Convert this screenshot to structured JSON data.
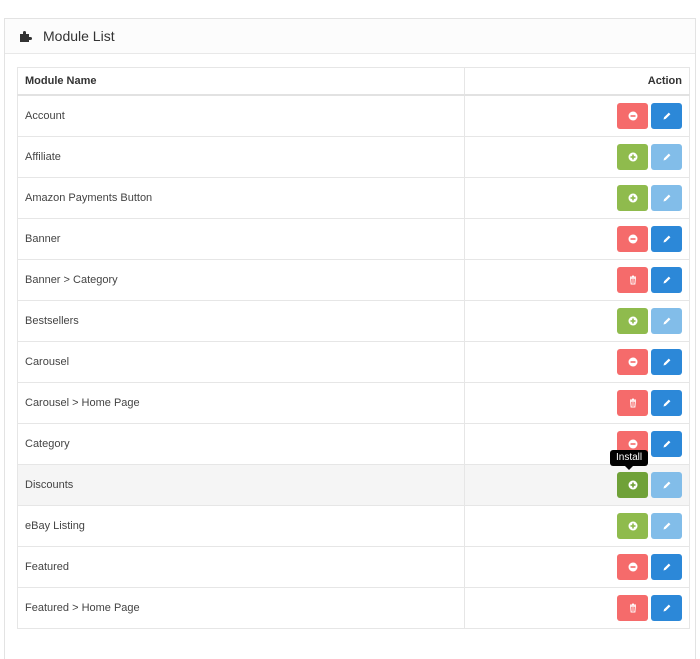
{
  "panel": {
    "title": "Module List",
    "title_icon": "puzzle-icon"
  },
  "table": {
    "headers": {
      "name": "Module Name",
      "action": "Action"
    },
    "rows": [
      {
        "name": "Account",
        "primary": "uninstall",
        "edit_enabled": true
      },
      {
        "name": "Affiliate",
        "primary": "install",
        "edit_enabled": false
      },
      {
        "name": "Amazon Payments Button",
        "primary": "install",
        "edit_enabled": false
      },
      {
        "name": "Banner",
        "primary": "uninstall",
        "edit_enabled": true
      },
      {
        "name": "Banner > Category",
        "primary": "delete",
        "edit_enabled": true
      },
      {
        "name": "Bestsellers",
        "primary": "install",
        "edit_enabled": false
      },
      {
        "name": "Carousel",
        "primary": "uninstall",
        "edit_enabled": true
      },
      {
        "name": "Carousel > Home Page",
        "primary": "delete",
        "edit_enabled": true
      },
      {
        "name": "Category",
        "primary": "uninstall",
        "edit_enabled": true
      },
      {
        "name": "Discounts",
        "primary": "install",
        "edit_enabled": false,
        "hovered": true
      },
      {
        "name": "eBay Listing",
        "primary": "install",
        "edit_enabled": false
      },
      {
        "name": "Featured",
        "primary": "uninstall",
        "edit_enabled": true
      },
      {
        "name": "Featured > Home Page",
        "primary": "delete",
        "edit_enabled": true
      }
    ]
  },
  "tooltip": {
    "text": "Install"
  },
  "colors": {
    "danger": "#f56b6b",
    "success": "#8fbb4d",
    "primary": "#2c88d8",
    "primary_disabled": "#82bde9"
  }
}
